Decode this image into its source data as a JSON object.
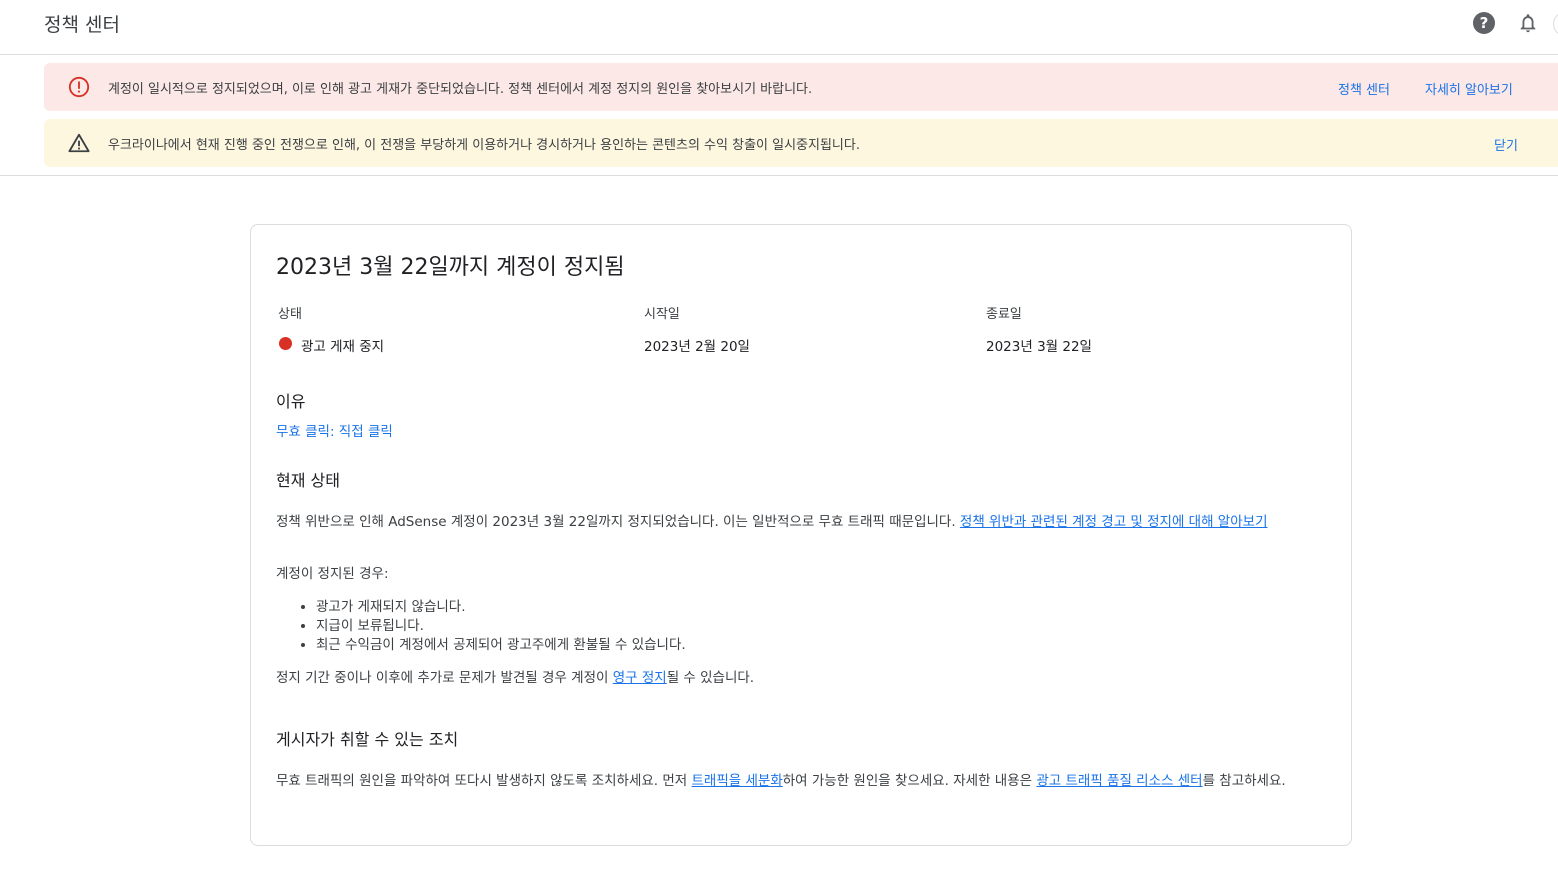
{
  "header": {
    "title": "정책 센터",
    "help_icon_glyph": "?"
  },
  "banners": {
    "error": {
      "icon": "error-icon",
      "message": "계정이 일시적으로 정지되었으며, 이로 인해 광고 게재가 중단되었습니다. 정책 센터에서 계정 정지의 원인을 찾아보시기 바랍니다.",
      "link1": "정책 센터",
      "link2": "자세히 알아보기",
      "color": "#d93025",
      "background": "#fce8e6"
    },
    "warning": {
      "icon": "warning-icon",
      "message": "우크라이나에서 현재 진행 중인 전쟁으로 인해, 이 전쟁을 부당하게 이용하거나 경시하거나 용인하는 콘텐츠의 수익 창출이 일시중지됩니다.",
      "link": "닫기",
      "background": "#fef7e0"
    }
  },
  "card": {
    "title": "2023년 3월 22일까지 계정이 정지됨",
    "columns": {
      "status_label": "상태",
      "status_value": "광고 게재 중지",
      "status_color": "#d93025",
      "start_label": "시작일",
      "start_value": "2023년 2월 20일",
      "end_label": "종료일",
      "end_value": "2023년 3월 22일"
    },
    "reason_heading": "이유",
    "reason_link": "무효 클릭: 직접 클릭",
    "current_heading": "현재 상태",
    "current_para_text": "정책 위반으로 인해 AdSense 계정이 2023년 3월 22일까지 정지되었습니다. 이는 일반적으로 무효 트래픽 때문입니다. ",
    "current_para_link": "정책 위반과 관련된 계정 경고 및 정지에 대해 알아보기",
    "suspended_intro": "계정이 정지된 경우:",
    "bullets": [
      "광고가 게재되지 않습니다.",
      "지급이 보류됩니다.",
      "최근 수익금이 계정에서 공제되어 광고주에게 환불될 수 있습니다."
    ],
    "permanent_text_before": "정지 기간 중이나 이후에 추가로 문제가 발견될 경우 계정이 ",
    "permanent_link": "영구 정지",
    "permanent_text_after": "될 수 있습니다.",
    "actions_heading": "게시자가 취할 수 있는 조치",
    "actions_text1": "무효 트래픽의 원인을 파악하여 또다시 발생하지 않도록 조치하세요. 먼저 ",
    "actions_link1": "트래픽을 세분화",
    "actions_text2": "하여 가능한 원인을 찾으세요. 자세한 내용은 ",
    "actions_link2": "광고 트래픽 품질 리소스 센터",
    "actions_text3": "를 참고하세요."
  }
}
